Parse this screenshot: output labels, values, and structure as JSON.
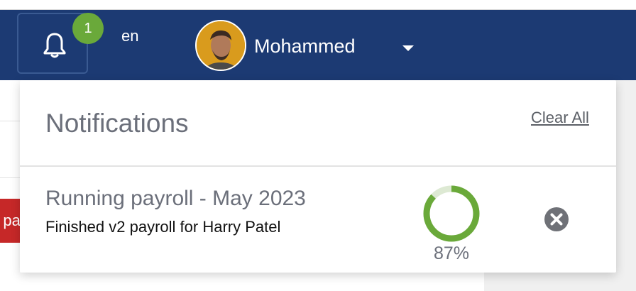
{
  "header": {
    "notification_count": "1",
    "language": "en",
    "user_name": "Mohammed"
  },
  "background": {
    "red_button_fragment": "e pa"
  },
  "notifications": {
    "title": "Notifications",
    "clear_all_label": "Clear All",
    "items": [
      {
        "title": "Running payroll - May 2023",
        "subtitle": "Finished v2 payroll for Harry Patel",
        "progress_percent": 87,
        "progress_label": "87%"
      }
    ]
  },
  "colors": {
    "topbar": "#1c3a73",
    "badge": "#6aa93a",
    "progress": "#6aa93a",
    "progress_track": "#dde9d3",
    "danger": "#c62828"
  },
  "icons": {
    "notification": "bell-icon",
    "menu_toggle": "chevron-down-icon",
    "dismiss": "close-circle-icon"
  }
}
